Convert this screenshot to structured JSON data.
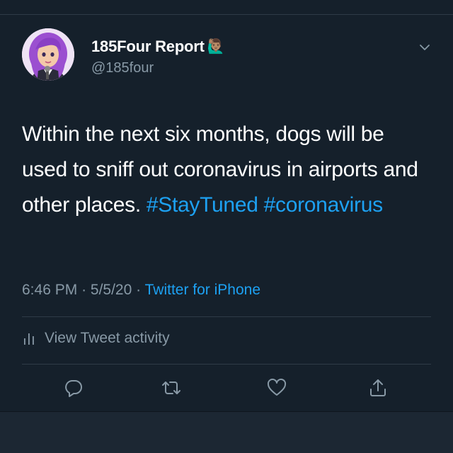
{
  "author": {
    "display_name": "185Four Report",
    "name_emoji": "🙋🏽‍♂️",
    "handle": "@185four"
  },
  "tweet": {
    "text_plain": "Within the next six months, dogs will be used to sniff out coronavirus in airports and other places.",
    "hashtag_1": "#StayTuned",
    "hashtag_2": "#coronavirus"
  },
  "meta": {
    "time": "6:46 PM",
    "separator": "·",
    "date": "5/5/20",
    "source": "Twitter for iPhone"
  },
  "activity": {
    "label": "View Tweet activity"
  },
  "icons": {
    "chevron": "chevron-down-icon",
    "activity": "bar-chart-icon",
    "reply": "reply-icon",
    "retweet": "retweet-icon",
    "like": "heart-icon",
    "share": "share-icon"
  },
  "colors": {
    "background": "#15202b",
    "accent": "#1da1f2",
    "secondary_text": "#8899a6",
    "divider": "#2f3b47"
  }
}
